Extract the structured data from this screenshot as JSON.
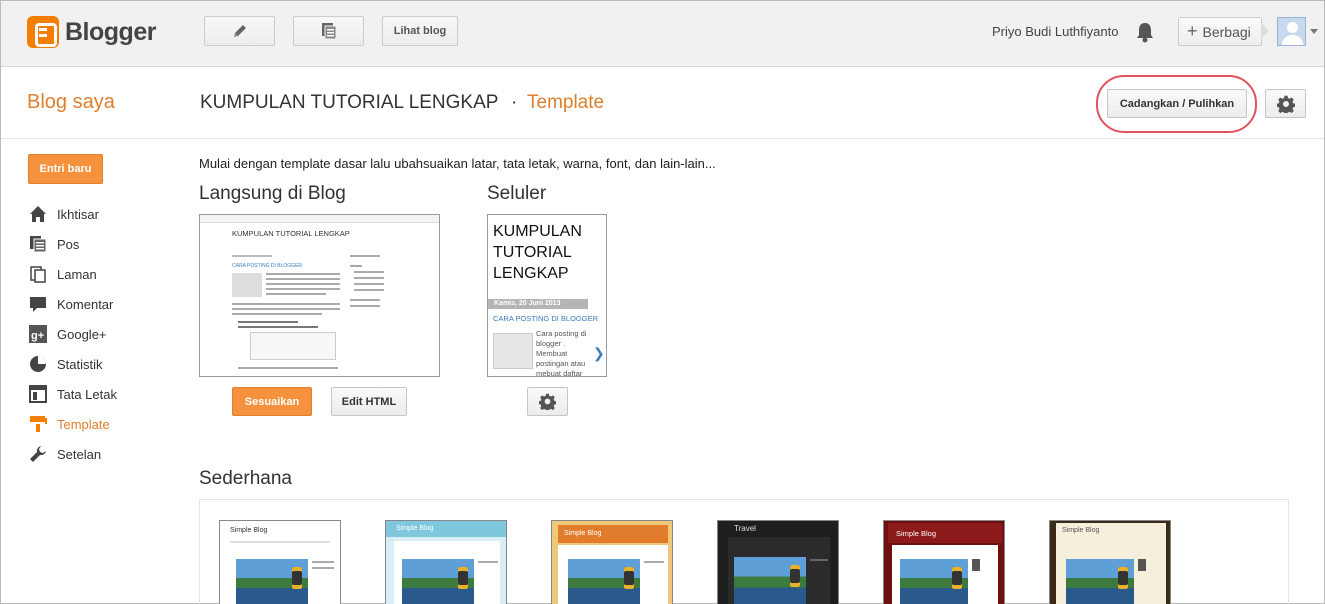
{
  "app": {
    "logo_text": "Blogger"
  },
  "topbar": {
    "view_blog_label": "Lihat blog",
    "username": "Priyo Budi Luthfiyanto",
    "share_label": "Berbagi"
  },
  "header": {
    "my_blogs": "Blog saya",
    "blog_name": "KUMPULAN TUTORIAL LENGKAP",
    "separator": "·",
    "section": "Template",
    "backup_label": "Cadangkan / Pulihkan"
  },
  "sidebar": {
    "new_post_label": "Entri baru",
    "items": [
      {
        "label": "Ikhtisar",
        "icon": "home-icon"
      },
      {
        "label": "Pos",
        "icon": "posts-icon"
      },
      {
        "label": "Laman",
        "icon": "pages-icon"
      },
      {
        "label": "Komentar",
        "icon": "comment-icon"
      },
      {
        "label": "Google+",
        "icon": "google-plus-icon"
      },
      {
        "label": "Statistik",
        "icon": "stats-icon"
      },
      {
        "label": "Tata Letak",
        "icon": "layout-icon"
      },
      {
        "label": "Template",
        "icon": "template-icon",
        "active": true
      },
      {
        "label": "Setelan",
        "icon": "wrench-icon"
      }
    ]
  },
  "main": {
    "intro": "Mulai dengan template dasar lalu ubahsuaikan latar, tata letak, warna, font, dan lain-lain...",
    "live_heading": "Langsung di Blog",
    "mobile_heading": "Seluler",
    "customize_label": "Sesuaikan",
    "edit_html_label": "Edit HTML",
    "simple_heading": "Sederhana",
    "live_preview": {
      "title": "KUMPULAN TUTORIAL LENGKAP",
      "post_title": "CARA POSTING DI BLOGGER"
    },
    "mobile_preview": {
      "title": "KUMPULAN TUTORIAL LENGKAP",
      "date": "Kamis, 20 Juni 2013",
      "post_title": "CARA POSTING DI BLOGGER",
      "snippet": "Cara posting di blogger . Membuat postingan atau mebuat daftar"
    },
    "templates": [
      {
        "title": "Simple Blog",
        "header_color": "#ffffff",
        "bg": "#ffffff",
        "title_color": "#444444"
      },
      {
        "title": "Simple Blog",
        "header_color": "#7fc7dd",
        "bg": "#d9eef4",
        "title_color": "#ffffff"
      },
      {
        "title": "Simple Blog",
        "header_color": "#e07c2c",
        "bg": "#f0c87a",
        "title_color": "#ffffff"
      },
      {
        "title": "Travel",
        "header_color": "#2b2b2b",
        "bg": "#1e1e1e",
        "title_color": "#dddddd"
      },
      {
        "title": "Simple Blog",
        "header_color": "#8c1a1a",
        "bg": "#6e0f0f",
        "title_color": "#ffffff"
      },
      {
        "title": "Simple Blog",
        "header_color": "#f5efdc",
        "bg": "#3a2a1a",
        "title_color": "#555555"
      }
    ]
  },
  "colors": {
    "accent": "#dd7f2d",
    "primary_button": "#f6923e",
    "highlight_ring": "#e0525f"
  }
}
